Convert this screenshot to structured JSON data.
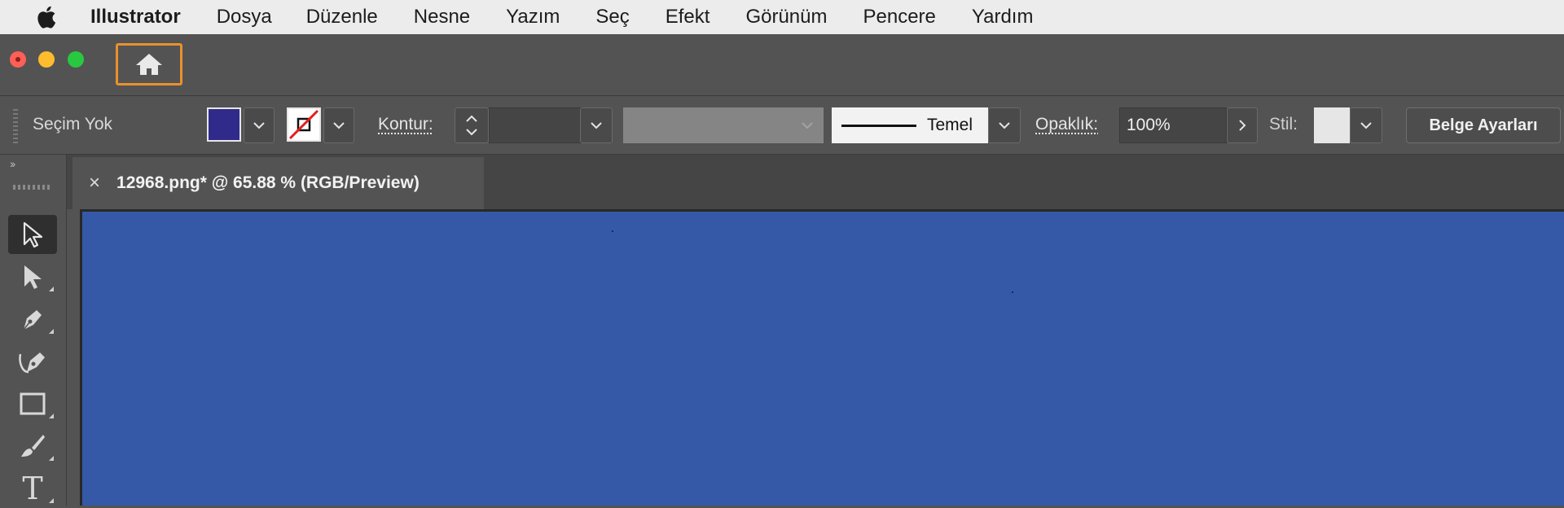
{
  "menubar": {
    "apple_icon": "apple-logo-icon",
    "app_name": "Illustrator",
    "items": [
      "Dosya",
      "Düzenle",
      "Nesne",
      "Yazım",
      "Seç",
      "Efekt",
      "Görünüm",
      "Pencere",
      "Yardım"
    ]
  },
  "titlebar": {
    "home_icon": "home-icon",
    "highlight_color": "#e8912d"
  },
  "controlbar": {
    "selection_label": "Seçim Yok",
    "fill_color": "#302b8a",
    "stroke_state": "none",
    "stroke_label": "Kontur:",
    "stroke_weight_value": "",
    "brush_value": "",
    "profile_label": "Temel",
    "opacity_label": "Opaklık:",
    "opacity_value": "100%",
    "style_label": "Stil:",
    "doc_settings_label": "Belge Ayarları"
  },
  "tabs": {
    "active_tab": "12968.png* @ 65.88 % (RGB/Preview)",
    "close_symbol": "×"
  },
  "toolbar": {
    "tools": [
      "selection-tool",
      "direct-selection-tool",
      "pen-tool",
      "curvature-tool",
      "rectangle-tool",
      "paintbrush-tool",
      "type-tool"
    ],
    "active_tool": "selection-tool",
    "type_glyph": "T"
  },
  "canvas": {
    "background_color": "#3559a7"
  }
}
